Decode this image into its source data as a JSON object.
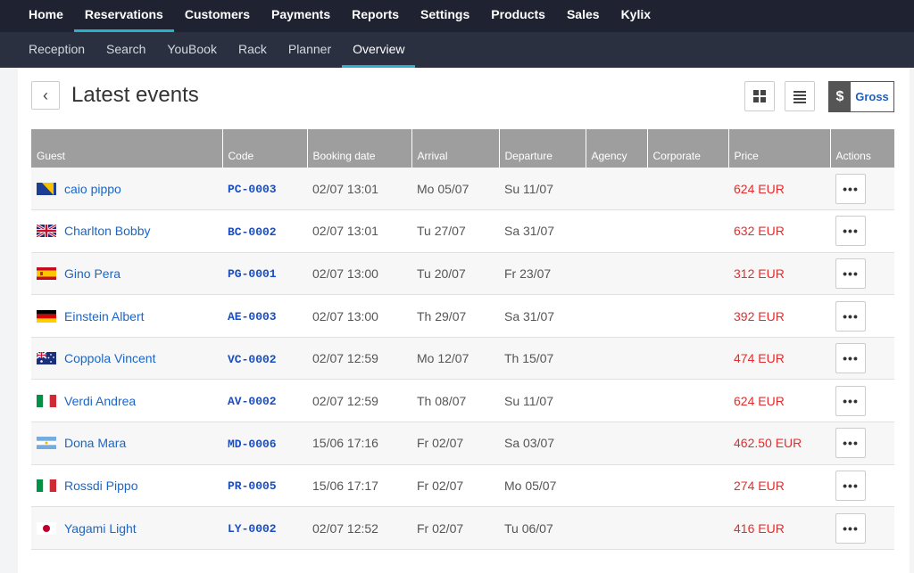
{
  "topnav": [
    "Home",
    "Reservations",
    "Customers",
    "Payments",
    "Reports",
    "Settings",
    "Products",
    "Sales",
    "Kylix"
  ],
  "topnav_active": 1,
  "subnav": [
    "Reception",
    "Search",
    "YouBook",
    "Rack",
    "Planner",
    "Overview"
  ],
  "subnav_active": 5,
  "page": {
    "title": "Latest events",
    "back_icon": "chevron-left-icon"
  },
  "toolbar": {
    "grid_icon": "grid-icon",
    "list_icon": "list-icon",
    "currency_symbol": "$",
    "gross_label": "Gross"
  },
  "table": {
    "columns": [
      "Guest",
      "Code",
      "Booking date",
      "Arrival",
      "Departure",
      "Agency",
      "Corporate",
      "Price",
      "Actions"
    ],
    "rows": [
      {
        "flag": "bosnia",
        "guest": "caio pippo",
        "code": "PC-0003",
        "booking": "02/07 13:01",
        "arrival": "Mo 05/07",
        "departure": "Su 11/07",
        "agency": "",
        "corporate": "",
        "price": "624 EUR"
      },
      {
        "flag": "uk",
        "guest": "Charlton Bobby",
        "code": "BC-0002",
        "booking": "02/07 13:01",
        "arrival": "Tu 27/07",
        "departure": "Sa 31/07",
        "agency": "",
        "corporate": "",
        "price": "632 EUR"
      },
      {
        "flag": "spain",
        "guest": "Gino Pera",
        "code": "PG-0001",
        "booking": "02/07 13:00",
        "arrival": "Tu 20/07",
        "departure": "Fr 23/07",
        "agency": "",
        "corporate": "",
        "price": "312 EUR"
      },
      {
        "flag": "germany",
        "guest": "Einstein Albert",
        "code": "AE-0003",
        "booking": "02/07 13:00",
        "arrival": "Th 29/07",
        "departure": "Sa 31/07",
        "agency": "",
        "corporate": "",
        "price": "392 EUR"
      },
      {
        "flag": "australia",
        "guest": "Coppola Vincent",
        "code": "VC-0002",
        "booking": "02/07 12:59",
        "arrival": "Mo 12/07",
        "departure": "Th 15/07",
        "agency": "",
        "corporate": "",
        "price": "474 EUR"
      },
      {
        "flag": "italy",
        "guest": "Verdi Andrea",
        "code": "AV-0002",
        "booking": "02/07 12:59",
        "arrival": "Th 08/07",
        "departure": "Su 11/07",
        "agency": "",
        "corporate": "",
        "price": "624 EUR"
      },
      {
        "flag": "argentina",
        "guest": "Dona Mara",
        "code": "MD-0006",
        "booking": "15/06 17:16",
        "arrival": "Fr 02/07",
        "departure": "Sa 03/07",
        "agency": "",
        "corporate": "",
        "price": "462.50 EUR"
      },
      {
        "flag": "italy",
        "guest": "Rossdi Pippo",
        "code": "PR-0005",
        "booking": "15/06 17:17",
        "arrival": "Fr 02/07",
        "departure": "Mo 05/07",
        "agency": "",
        "corporate": "",
        "price": "274 EUR"
      },
      {
        "flag": "japan",
        "guest": "Yagami Light",
        "code": "LY-0002",
        "booking": "02/07 12:52",
        "arrival": "Fr 02/07",
        "departure": "Tu 06/07",
        "agency": "",
        "corporate": "",
        "price": "416 EUR"
      }
    ],
    "actions_label": "•••"
  },
  "colors": {
    "nav_bg": "#1e2231",
    "subnav_bg": "#2b3040",
    "accent": "#2ab1c9",
    "price": "#e52c2c",
    "link": "#1a66c9",
    "header_bg": "#9e9e9e"
  }
}
